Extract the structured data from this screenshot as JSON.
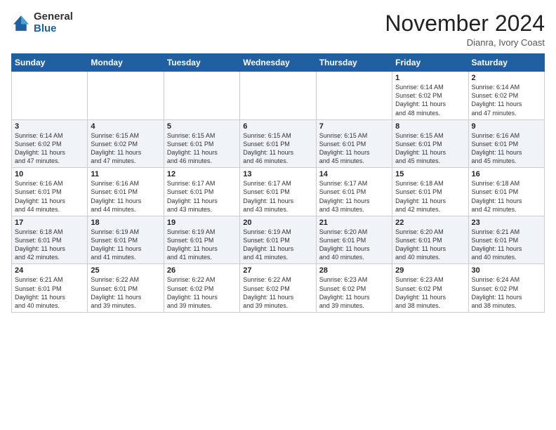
{
  "header": {
    "logo_general": "General",
    "logo_blue": "Blue",
    "month_title": "November 2024",
    "location": "Dianra, Ivory Coast"
  },
  "calendar": {
    "days_of_week": [
      "Sunday",
      "Monday",
      "Tuesday",
      "Wednesday",
      "Thursday",
      "Friday",
      "Saturday"
    ],
    "weeks": [
      [
        {
          "day": "",
          "info": ""
        },
        {
          "day": "",
          "info": ""
        },
        {
          "day": "",
          "info": ""
        },
        {
          "day": "",
          "info": ""
        },
        {
          "day": "",
          "info": ""
        },
        {
          "day": "1",
          "info": "Sunrise: 6:14 AM\nSunset: 6:02 PM\nDaylight: 11 hours\nand 48 minutes."
        },
        {
          "day": "2",
          "info": "Sunrise: 6:14 AM\nSunset: 6:02 PM\nDaylight: 11 hours\nand 47 minutes."
        }
      ],
      [
        {
          "day": "3",
          "info": "Sunrise: 6:14 AM\nSunset: 6:02 PM\nDaylight: 11 hours\nand 47 minutes."
        },
        {
          "day": "4",
          "info": "Sunrise: 6:15 AM\nSunset: 6:02 PM\nDaylight: 11 hours\nand 47 minutes."
        },
        {
          "day": "5",
          "info": "Sunrise: 6:15 AM\nSunset: 6:01 PM\nDaylight: 11 hours\nand 46 minutes."
        },
        {
          "day": "6",
          "info": "Sunrise: 6:15 AM\nSunset: 6:01 PM\nDaylight: 11 hours\nand 46 minutes."
        },
        {
          "day": "7",
          "info": "Sunrise: 6:15 AM\nSunset: 6:01 PM\nDaylight: 11 hours\nand 45 minutes."
        },
        {
          "day": "8",
          "info": "Sunrise: 6:15 AM\nSunset: 6:01 PM\nDaylight: 11 hours\nand 45 minutes."
        },
        {
          "day": "9",
          "info": "Sunrise: 6:16 AM\nSunset: 6:01 PM\nDaylight: 11 hours\nand 45 minutes."
        }
      ],
      [
        {
          "day": "10",
          "info": "Sunrise: 6:16 AM\nSunset: 6:01 PM\nDaylight: 11 hours\nand 44 minutes."
        },
        {
          "day": "11",
          "info": "Sunrise: 6:16 AM\nSunset: 6:01 PM\nDaylight: 11 hours\nand 44 minutes."
        },
        {
          "day": "12",
          "info": "Sunrise: 6:17 AM\nSunset: 6:01 PM\nDaylight: 11 hours\nand 43 minutes."
        },
        {
          "day": "13",
          "info": "Sunrise: 6:17 AM\nSunset: 6:01 PM\nDaylight: 11 hours\nand 43 minutes."
        },
        {
          "day": "14",
          "info": "Sunrise: 6:17 AM\nSunset: 6:01 PM\nDaylight: 11 hours\nand 43 minutes."
        },
        {
          "day": "15",
          "info": "Sunrise: 6:18 AM\nSunset: 6:01 PM\nDaylight: 11 hours\nand 42 minutes."
        },
        {
          "day": "16",
          "info": "Sunrise: 6:18 AM\nSunset: 6:01 PM\nDaylight: 11 hours\nand 42 minutes."
        }
      ],
      [
        {
          "day": "17",
          "info": "Sunrise: 6:18 AM\nSunset: 6:01 PM\nDaylight: 11 hours\nand 42 minutes."
        },
        {
          "day": "18",
          "info": "Sunrise: 6:19 AM\nSunset: 6:01 PM\nDaylight: 11 hours\nand 41 minutes."
        },
        {
          "day": "19",
          "info": "Sunrise: 6:19 AM\nSunset: 6:01 PM\nDaylight: 11 hours\nand 41 minutes."
        },
        {
          "day": "20",
          "info": "Sunrise: 6:19 AM\nSunset: 6:01 PM\nDaylight: 11 hours\nand 41 minutes."
        },
        {
          "day": "21",
          "info": "Sunrise: 6:20 AM\nSunset: 6:01 PM\nDaylight: 11 hours\nand 40 minutes."
        },
        {
          "day": "22",
          "info": "Sunrise: 6:20 AM\nSunset: 6:01 PM\nDaylight: 11 hours\nand 40 minutes."
        },
        {
          "day": "23",
          "info": "Sunrise: 6:21 AM\nSunset: 6:01 PM\nDaylight: 11 hours\nand 40 minutes."
        }
      ],
      [
        {
          "day": "24",
          "info": "Sunrise: 6:21 AM\nSunset: 6:01 PM\nDaylight: 11 hours\nand 40 minutes."
        },
        {
          "day": "25",
          "info": "Sunrise: 6:22 AM\nSunset: 6:01 PM\nDaylight: 11 hours\nand 39 minutes."
        },
        {
          "day": "26",
          "info": "Sunrise: 6:22 AM\nSunset: 6:02 PM\nDaylight: 11 hours\nand 39 minutes."
        },
        {
          "day": "27",
          "info": "Sunrise: 6:22 AM\nSunset: 6:02 PM\nDaylight: 11 hours\nand 39 minutes."
        },
        {
          "day": "28",
          "info": "Sunrise: 6:23 AM\nSunset: 6:02 PM\nDaylight: 11 hours\nand 39 minutes."
        },
        {
          "day": "29",
          "info": "Sunrise: 6:23 AM\nSunset: 6:02 PM\nDaylight: 11 hours\nand 38 minutes."
        },
        {
          "day": "30",
          "info": "Sunrise: 6:24 AM\nSunset: 6:02 PM\nDaylight: 11 hours\nand 38 minutes."
        }
      ]
    ]
  }
}
